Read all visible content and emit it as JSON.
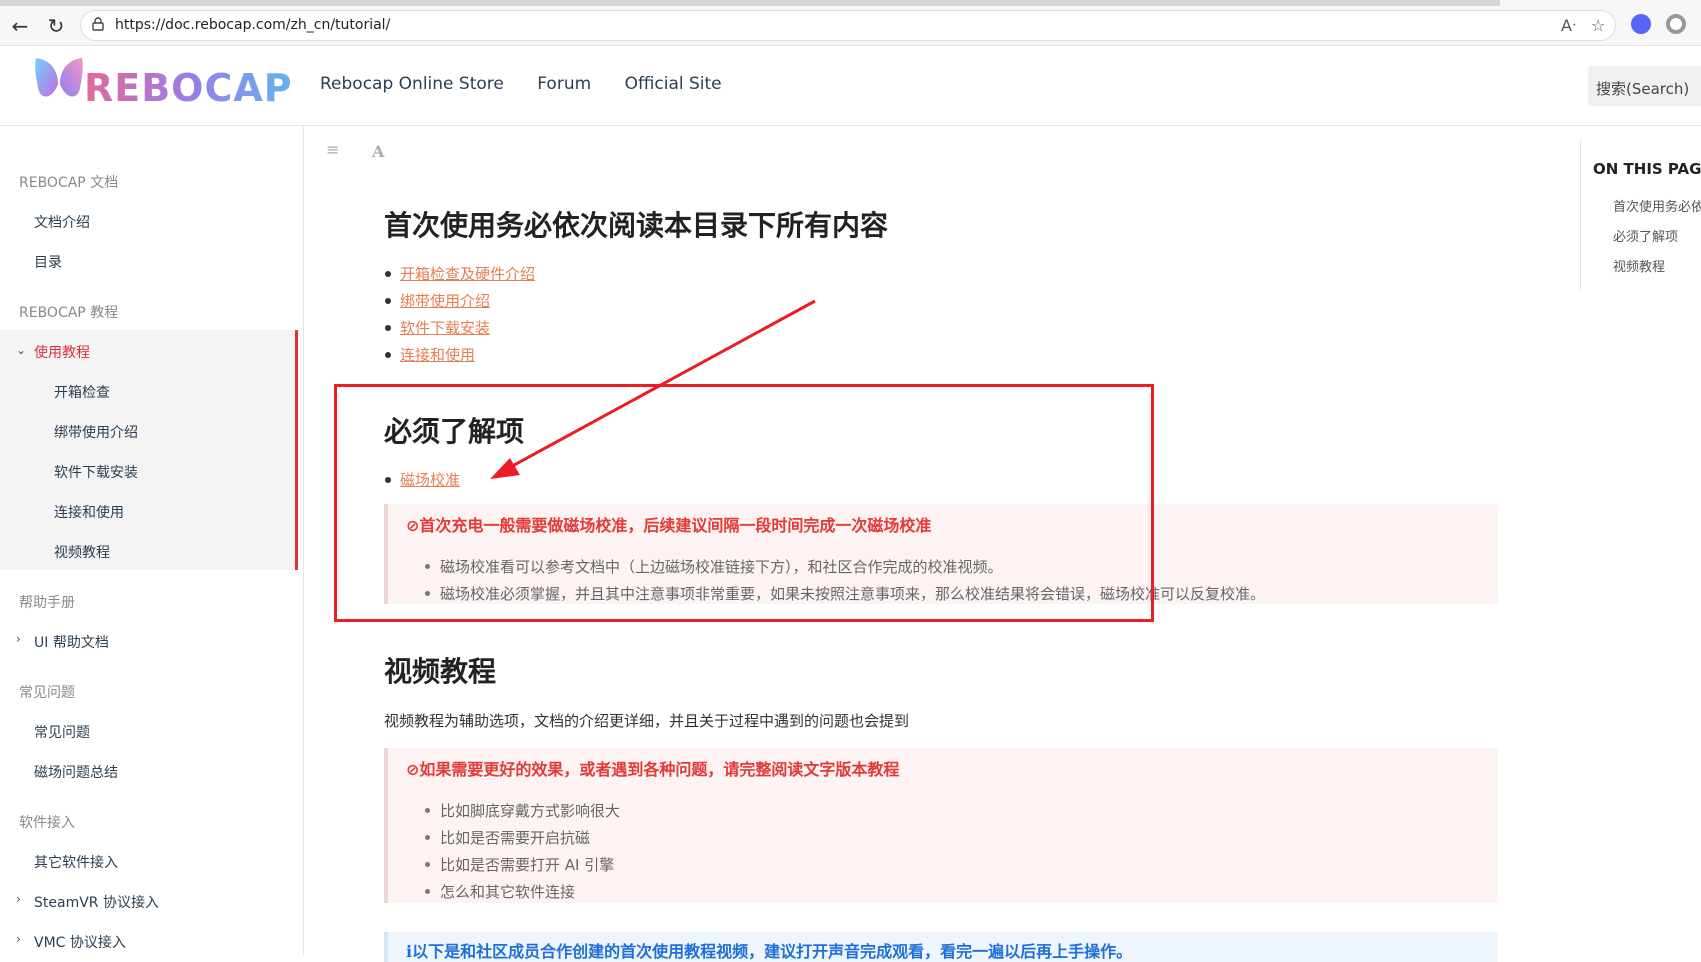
{
  "browser": {
    "url": "https://doc.rebocap.com/zh_cn/tutorial/",
    "back_icon": "arrow-left-icon",
    "reload_icon": "reload-icon",
    "read_aloud_icon": "read-aloud-icon",
    "favorite_icon": "star-icon"
  },
  "header": {
    "logo_text": "REBOCAP",
    "nav": [
      "Rebocap Online Store",
      "Forum",
      "Official Site"
    ],
    "search_placeholder": "搜索(Search)"
  },
  "sidebar": {
    "sections": [
      {
        "title": "REBOCAP 文档",
        "items": [
          "文档介绍",
          "目录"
        ]
      },
      {
        "title": "REBOCAP 教程",
        "group": "使用教程",
        "subitems": [
          "开箱检查",
          "绑带使用介绍",
          "软件下载安装",
          "连接和使用",
          "视频教程"
        ]
      },
      {
        "title": "帮助手册",
        "items": [
          "UI 帮助文档"
        ]
      },
      {
        "title": "常见问题",
        "items": [
          "常见问题",
          "磁场问题总结"
        ]
      },
      {
        "title": "软件接入",
        "items": [
          "其它软件接入",
          "SteamVR 协议接入",
          "VMC 协议接入"
        ]
      }
    ]
  },
  "content": {
    "title": "首次使用务必依次阅读本目录下所有内容",
    "links": [
      "开箱检查及硬件介绍",
      "绑带使用介绍",
      "软件下载安装",
      "连接和使用"
    ],
    "must_know": {
      "heading": "必须了解项",
      "link": "磁场校准",
      "callout_title": "⊘首次充电一般需要做磁场校准，后续建议间隔一段时间完成一次磁场校准",
      "callout_items": [
        "磁场校准看可以参考文档中（上边磁场校准链接下方），和社区合作完成的校准视频。",
        "磁场校准必须掌握，并且其中注意事项非常重要，如果未按照注意事项来，那么校准结果将会错误，磁场校准可以反复校准。"
      ]
    },
    "video": {
      "heading": "视频教程",
      "paragraph": "视频教程为辅助选项，文档的介绍更详细，并且关于过程中遇到的问题也会提到",
      "callout_title": "⊘如果需要更好的效果，或者遇到各种问题，请完整阅读文字版本教程",
      "callout_items": [
        "比如脚底穿戴方式影响很大",
        "比如是否需要开启抗磁",
        "比如是否需要打开 AI 引擎",
        "怎么和其它软件连接"
      ],
      "info_title": "ℹ以下是和社区成员合作创建的首次使用教程视频，建议打开声音完成观看，看完一遍以后再上手操作。"
    }
  },
  "toc": {
    "title": "ON THIS PAGE",
    "items": [
      "首次使用务必依",
      "必须了解项",
      "视频教程"
    ]
  },
  "colors": {
    "accent_red": "#e0303a",
    "link_orange": "#e67e52",
    "annotation_red": "#ee1c24"
  }
}
